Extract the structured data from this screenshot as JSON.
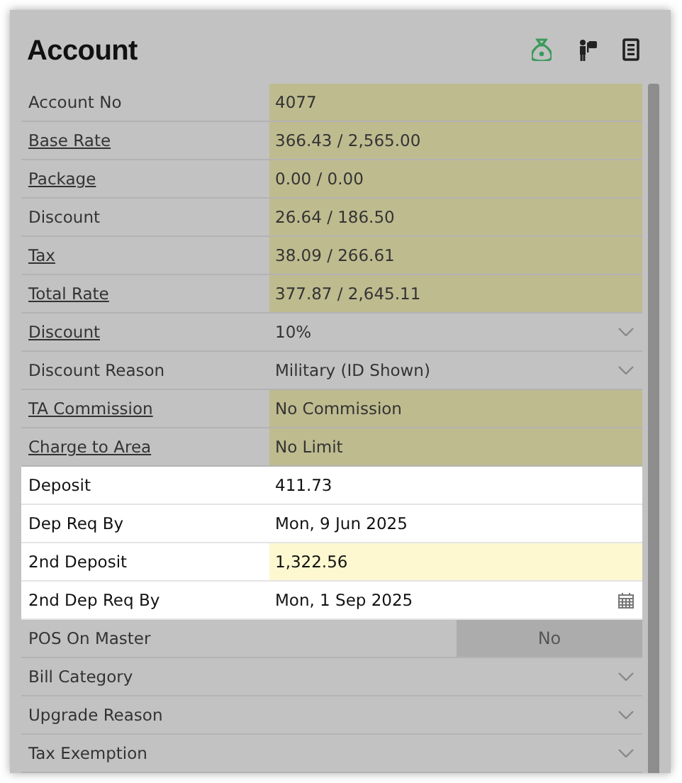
{
  "title": "Account",
  "rows": [
    {
      "label": "Account No",
      "link": false,
      "kind": "readonly",
      "focused": false,
      "value": "4077"
    },
    {
      "label": "Base Rate",
      "link": true,
      "kind": "readonly",
      "focused": false,
      "value": "366.43 / 2,565.00"
    },
    {
      "label": "Package",
      "link": true,
      "kind": "readonly",
      "focused": false,
      "value": "0.00 / 0.00"
    },
    {
      "label": "Discount",
      "link": false,
      "kind": "readonly",
      "focused": false,
      "value": "26.64 / 186.50"
    },
    {
      "label": "Tax",
      "link": true,
      "kind": "readonly",
      "focused": false,
      "value": "38.09 / 266.61"
    },
    {
      "label": "Total Rate",
      "link": true,
      "kind": "readonly",
      "focused": false,
      "value": "377.87 / 2,645.11"
    },
    {
      "label": "Discount",
      "link": true,
      "kind": "select",
      "focused": false,
      "value": "10%"
    },
    {
      "label": "Discount Reason",
      "link": false,
      "kind": "select",
      "focused": false,
      "value": "Military (ID Shown)"
    },
    {
      "label": "TA Commission",
      "link": true,
      "kind": "readonly",
      "focused": false,
      "value": "No Commission"
    },
    {
      "label": "Charge to Area",
      "link": true,
      "kind": "readonly",
      "focused": false,
      "value": "No Limit"
    },
    {
      "label": "Deposit",
      "link": false,
      "kind": "text",
      "focused": true,
      "value": "411.73"
    },
    {
      "label": "Dep Req By",
      "link": false,
      "kind": "text",
      "focused": true,
      "value": "Mon, 9 Jun 2025"
    },
    {
      "label": "2nd Deposit",
      "link": false,
      "kind": "input",
      "focused": true,
      "value": "1,322.56"
    },
    {
      "label": "2nd Dep Req By",
      "link": false,
      "kind": "date",
      "focused": true,
      "value": "Mon, 1 Sep 2025"
    },
    {
      "label": "POS On Master",
      "link": false,
      "kind": "toggle",
      "focused": false,
      "value": "No"
    },
    {
      "label": "Bill Category",
      "link": false,
      "kind": "select",
      "focused": false
    },
    {
      "label": "Upgrade Reason",
      "link": false,
      "kind": "select",
      "focused": false
    },
    {
      "label": "Tax Exemption",
      "link": false,
      "kind": "select",
      "focused": false
    }
  ]
}
